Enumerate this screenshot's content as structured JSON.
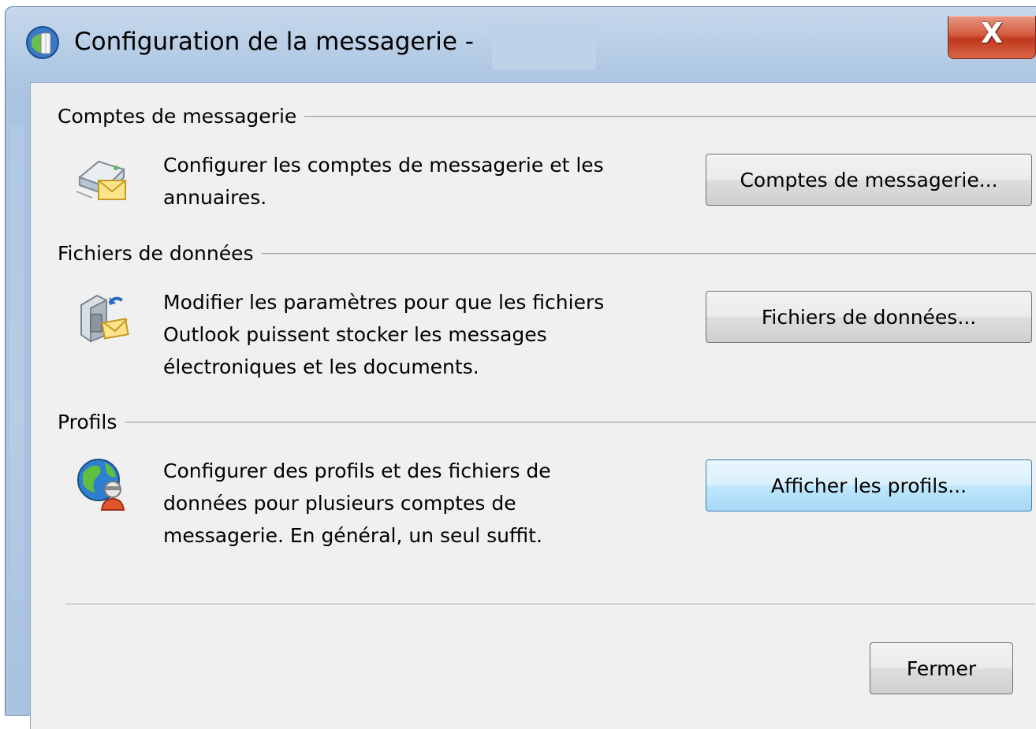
{
  "window": {
    "title": "Configuration de la messagerie -",
    "close_label": "X"
  },
  "groups": [
    {
      "label": "Comptes de messagerie",
      "icon": "mail-account-icon",
      "description": "Configurer les comptes de messagerie et les\nannuaires.",
      "button": "Comptes de messagerie..."
    },
    {
      "label": "Fichiers de données",
      "icon": "data-file-icon",
      "description": "Modifier les paramètres pour que les fichiers\nOutlook puissent stocker les messages\nélectroniques et les documents.",
      "button": "Fichiers de données..."
    },
    {
      "label": "Profils",
      "icon": "profile-globe-icon",
      "description": "Configurer des profils et des fichiers de\ndonnées pour plusieurs comptes de\nmessagerie. En général, un seul suffit.",
      "button": "Afficher les profils..."
    }
  ],
  "footer": {
    "close_button": "Fermer"
  },
  "colors": {
    "default_button_border": "#3c7fb1",
    "close_button_red": "#c1371a",
    "dialog_background": "#f0f0f0"
  }
}
